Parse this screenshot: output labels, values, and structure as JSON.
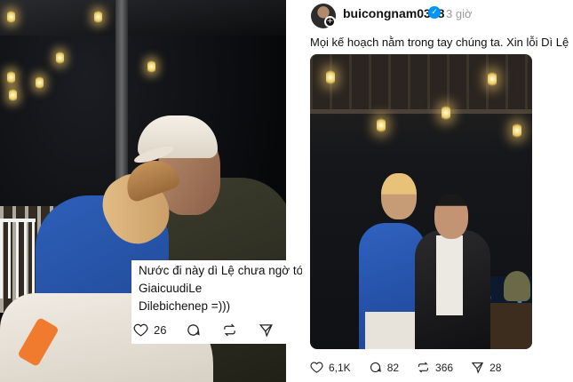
{
  "comment": {
    "lines": [
      "Nước đi này dì Lệ chưa ngờ tới phải không :)))",
      "GiaicuudiLe",
      "Dilebichenep =)))"
    ],
    "likes": "26"
  },
  "post": {
    "username": "buicongnam0308",
    "verified_icon": "verified-check-icon",
    "timestamp": "3 giờ",
    "caption": "Mọi kế hoạch nằm trong tay chúng ta. Xin lỗi Dì Lệ",
    "caption_emoji": "🙏",
    "likes": "6,1K",
    "comments": "82",
    "reposts": "366",
    "shares": "28"
  },
  "colors": {
    "verified_badge": "#0095f6",
    "text_primary": "#111111",
    "text_secondary": "#9a9a9a"
  }
}
